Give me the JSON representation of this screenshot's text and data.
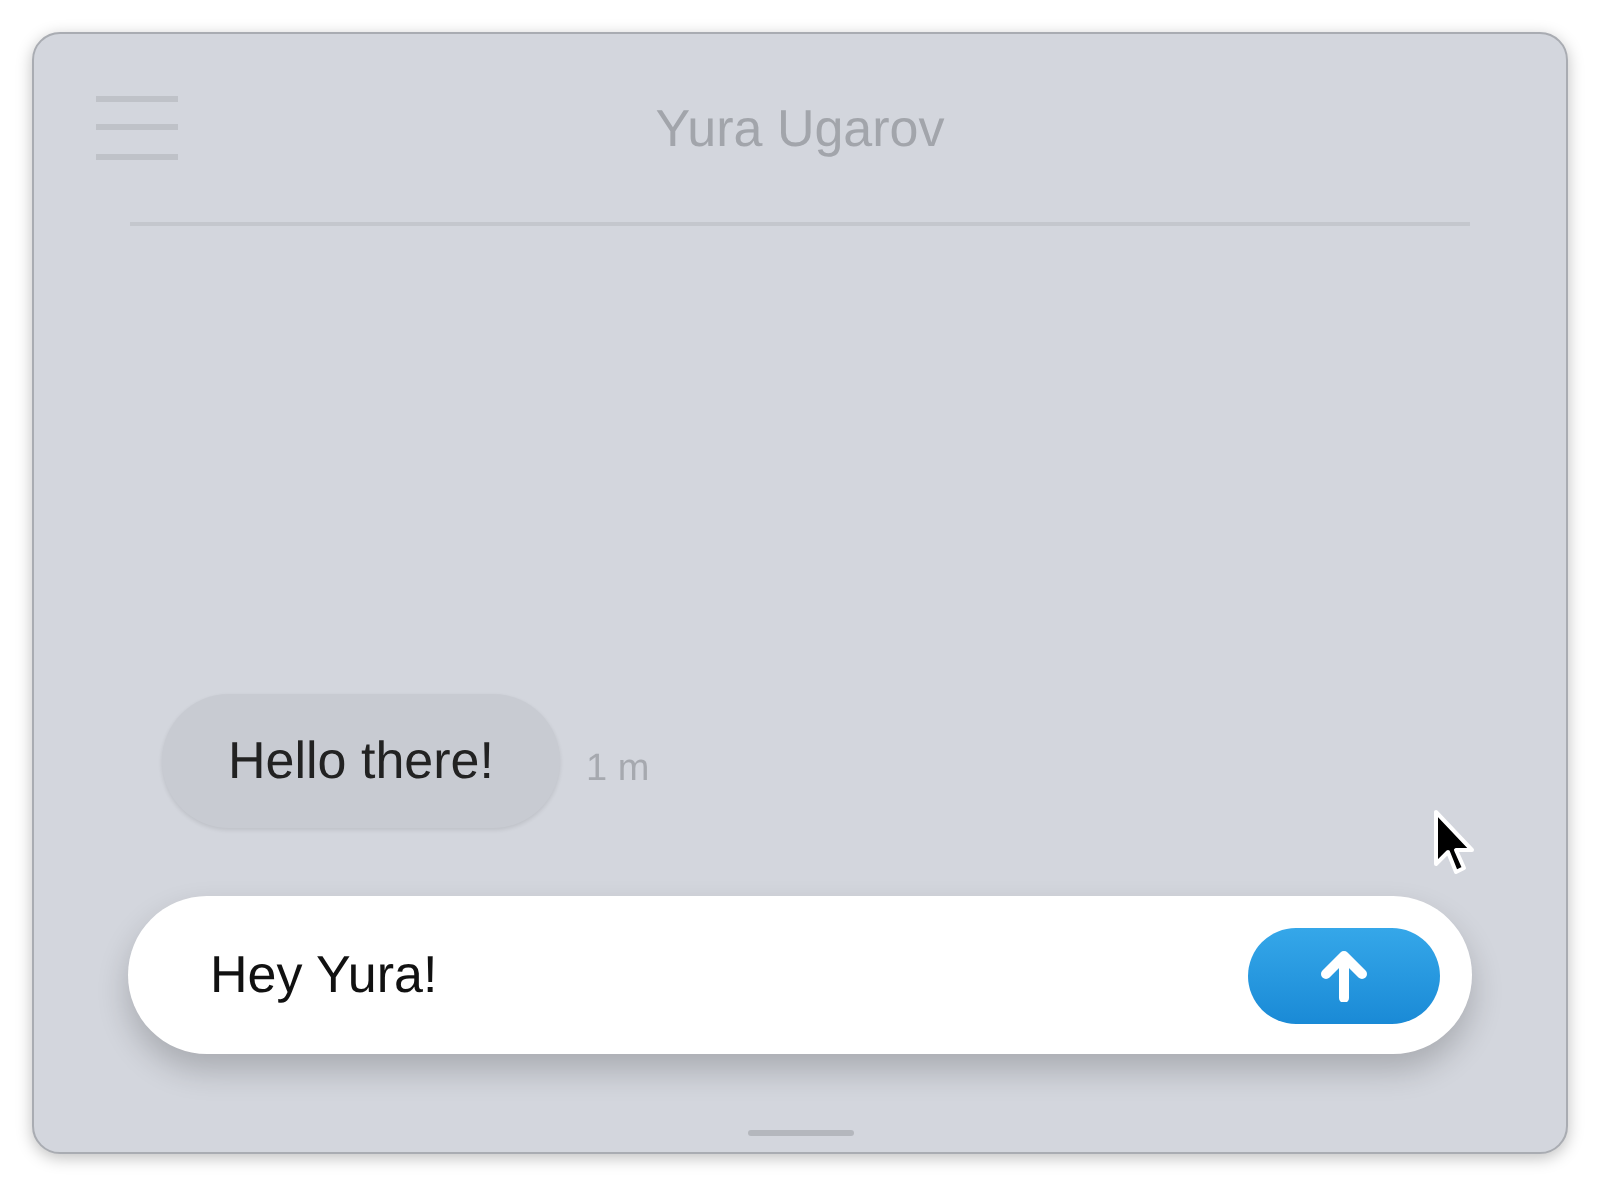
{
  "header": {
    "title": "Yura Ugarov"
  },
  "messages": [
    {
      "text": "Hello there!",
      "time": "1 m"
    }
  ],
  "composer": {
    "value": "Hey Yura!"
  }
}
